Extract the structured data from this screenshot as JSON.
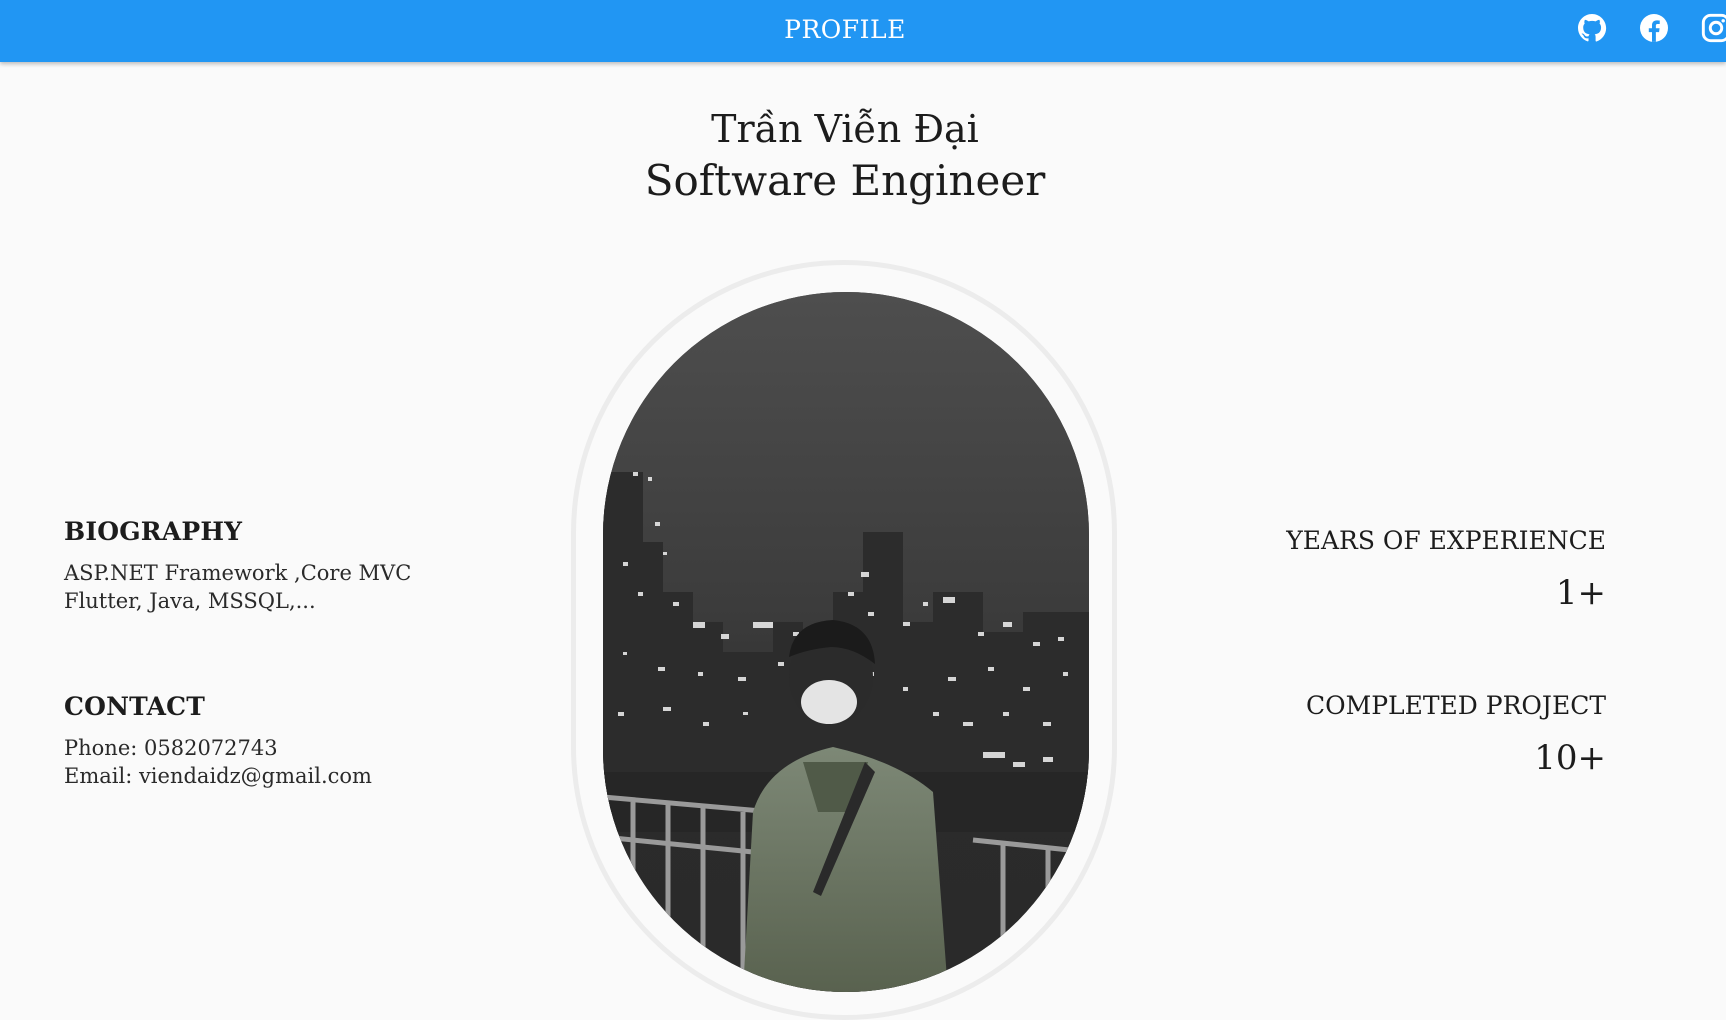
{
  "appbar": {
    "title": "PROFILE",
    "background_color": "#2196f3",
    "icons": [
      "github-icon",
      "facebook-icon",
      "instagram-icon"
    ]
  },
  "profile": {
    "name": "Trần Viễn Đại",
    "role": "Software Engineer"
  },
  "biography": {
    "title": "BIOGRAPHY",
    "lines": [
      "ASP.NET Framework ,Core MVC",
      "Flutter, Java, MSSQL,..."
    ]
  },
  "contact": {
    "title": "CONTACT",
    "phone": "Phone: 0582072743",
    "email": "Email: viendaidz@gmail.com"
  },
  "stats": {
    "experience_label": "YEARS OF EXPERIENCE",
    "experience_value": "1+",
    "projects_label": "COMPLETED PROJECT",
    "projects_value": "10+"
  }
}
